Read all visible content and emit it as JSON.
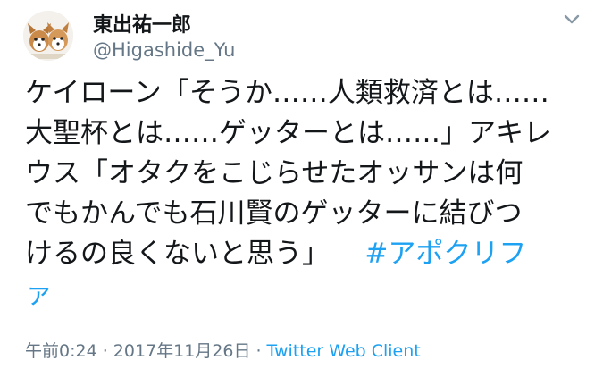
{
  "user": {
    "display_name": "東出祐一郎",
    "handle": "@Higashide_Yu",
    "avatar_icon": "dog-avatar-icon"
  },
  "tweet": {
    "lines": [
      "ケイローン「そうか……人類救済とは……",
      "大聖杯とは……ゲッターとは……」アキレ",
      "ウス「オタクをこじらせたオッサンは何",
      "でもかんでも石川賢のゲッターに結びつ",
      "けるの良くないと思う」"
    ],
    "hashtag_part1": "#アポクリフ",
    "hashtag_part2": "ァ"
  },
  "meta": {
    "timestamp": "午前0:24 · 2017年11月26日",
    "separator": "·",
    "client": "Twitter Web Client"
  },
  "colors": {
    "link": "#1da1f2",
    "text": "#14171a",
    "secondary": "#657786"
  }
}
